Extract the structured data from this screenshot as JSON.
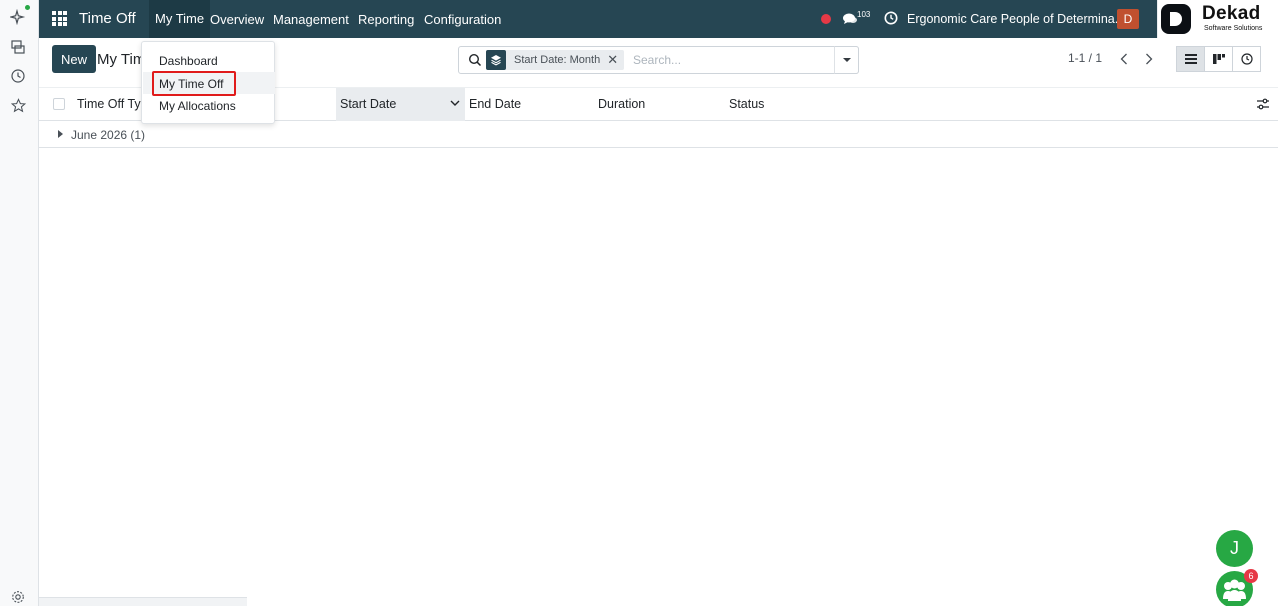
{
  "navbar": {
    "app_title": "Time Off",
    "menus": [
      "My Time",
      "Overview",
      "Management",
      "Reporting",
      "Configuration"
    ],
    "chat_count": "103",
    "company": "Ergonomic Care People of Determina...",
    "user_initial": "D"
  },
  "logo": {
    "name": "Dekad",
    "tagline": "Software Solutions"
  },
  "control": {
    "new_label": "New",
    "breadcrumb": "My Tim",
    "facet_label": "Start Date: Month",
    "search_placeholder": "Search...",
    "pager": "1-1 / 1"
  },
  "dropdown": {
    "items": [
      "Dashboard",
      "My Time Off",
      "My Allocations"
    ]
  },
  "table": {
    "columns": [
      "Time Off Typ",
      "Start Date",
      "End Date",
      "Duration",
      "Status"
    ],
    "group_label": "June 2026 (1)"
  },
  "chat_bubble": {
    "initial": "J",
    "badge": "6"
  },
  "colors": {
    "navbar": "#264653",
    "accent_green": "#27a844",
    "highlight_red": "#e01b1b"
  }
}
